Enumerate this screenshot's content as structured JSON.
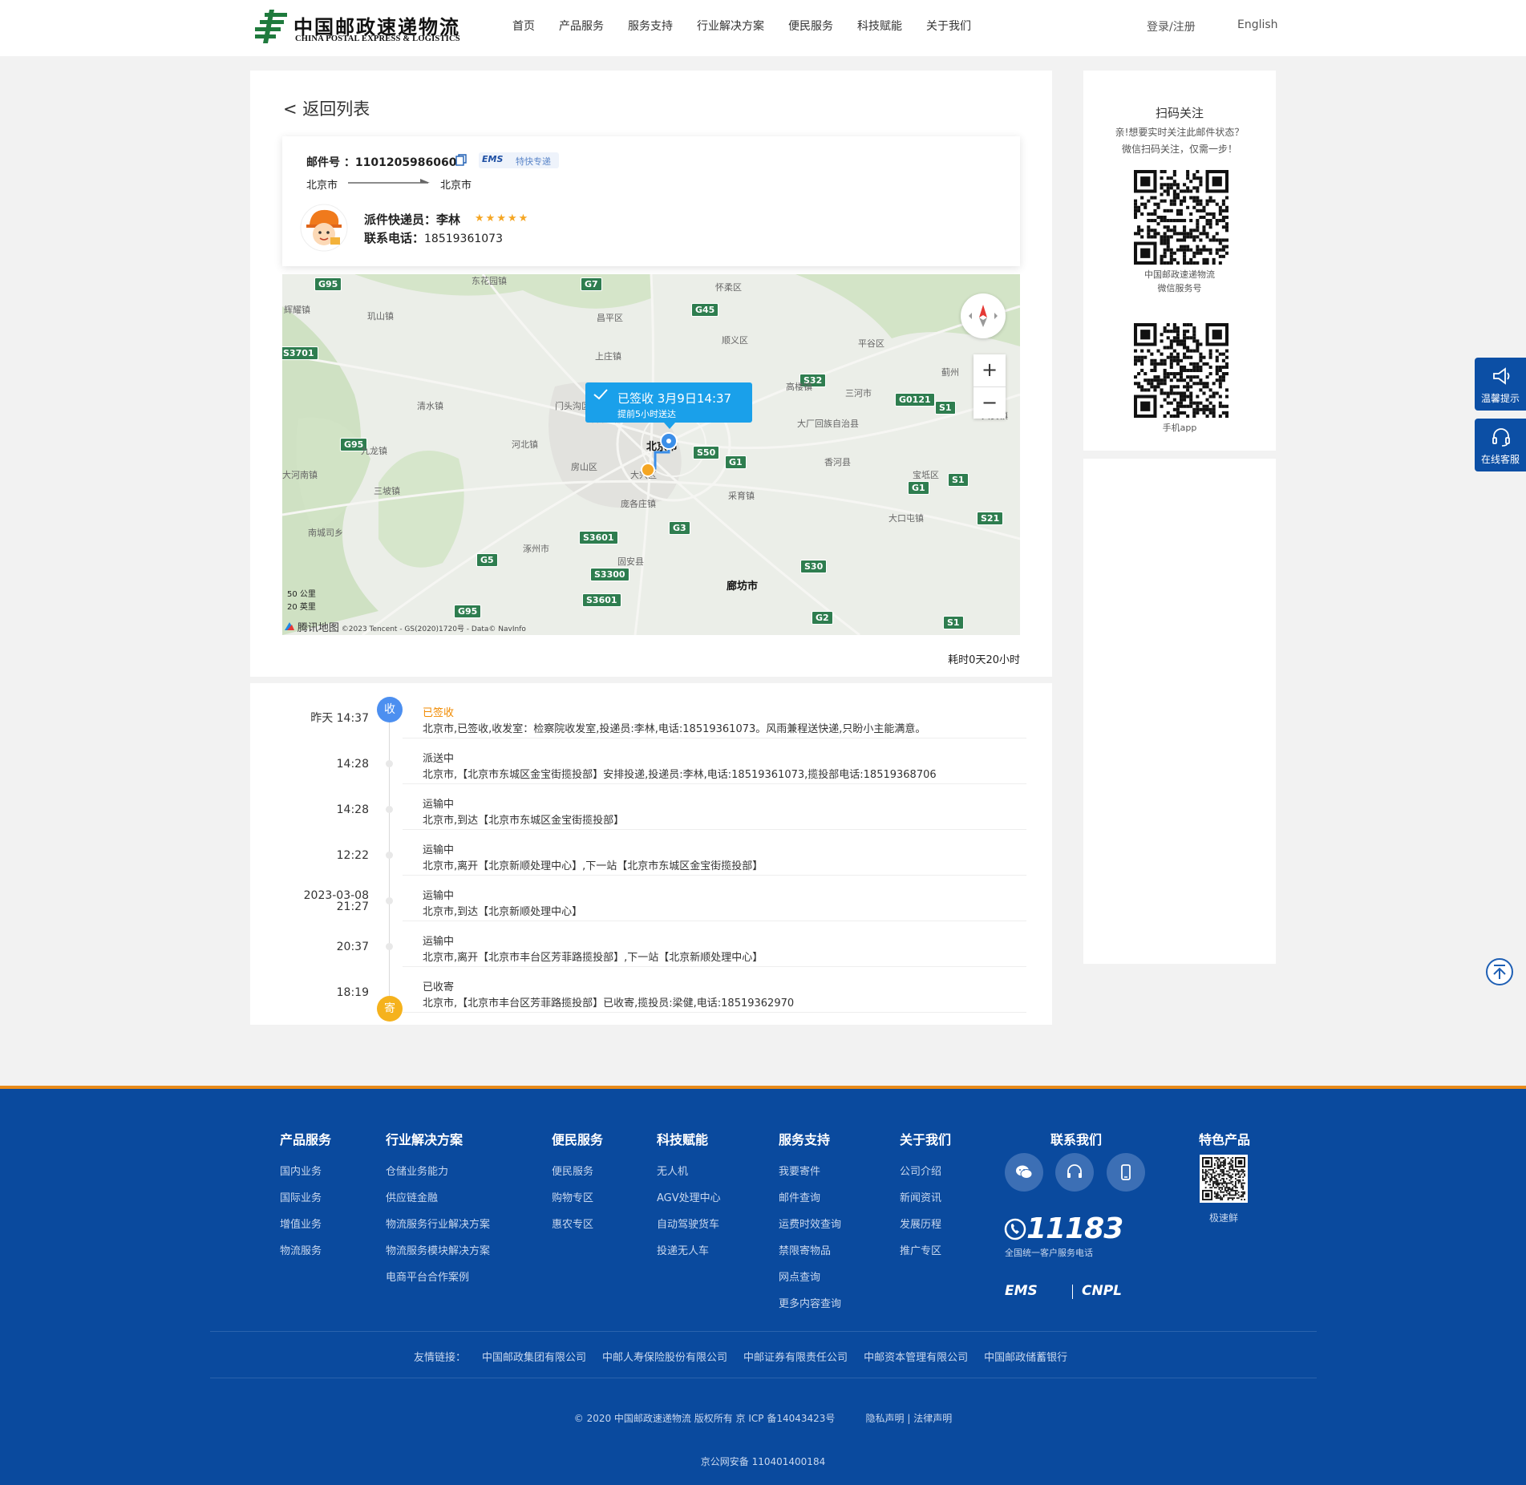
{
  "header": {
    "logo_cn": "中国邮政速递物流",
    "logo_en": "CHINA POSTAL EXPRESS & LOGISTICS",
    "nav": [
      "首页",
      "产品服务",
      "服务支持",
      "行业解决方案",
      "便民服务",
      "科技赋能",
      "关于我们"
    ],
    "login": "登录/注册",
    "language": "English"
  },
  "detail": {
    "back_label": "< 返回列表",
    "mail_no_label": "邮件号 ：1101205986060",
    "ems_logo": "EMS",
    "ems_type": "特快专递",
    "origin": "北京市",
    "destination": "北京市",
    "courier_label": "派件快递员：李林",
    "rating_stars": 5,
    "phone_label": "联系电话：",
    "phone_value": "18519361073",
    "duration": "耗时0天20小时"
  },
  "map": {
    "popup_title": "已签收  3月9日14:37",
    "popup_sub": "提前5小时送达",
    "city": "北京市",
    "city2": "廊坊市",
    "zoom_in": "+",
    "zoom_out": "−",
    "scale_metric": "50 公里",
    "scale_imperial": "20 英里",
    "provider": "腾讯地图",
    "attribution": "©2023 Tencent - GS(2020)1720号 - Data© NavInfo",
    "roads": [
      "G95",
      "G7",
      "G45",
      "S3701",
      "S32",
      "G0121",
      "S1",
      "G95",
      "S50",
      "G1",
      "G1",
      "S1",
      "S21",
      "G3",
      "S3601",
      "G5",
      "S3300",
      "S30",
      "S3601",
      "G95",
      "G2",
      "S1"
    ],
    "places": [
      "东花园镇",
      "怀柔区",
      "辉耀镇",
      "玑山镇",
      "昌平区",
      "顺义区",
      "平谷区",
      "上庄镇",
      "高楼镇",
      "三河市",
      "清水镇",
      "门头沟区",
      "石景山区",
      "大厂回族自治县",
      "九龙镇",
      "河北镇",
      "房山区",
      "大兴区",
      "香河县",
      "宝坻区",
      "大河南镇",
      "三坡镇",
      "庞各庄镇",
      "采育镇",
      "大口屯镇",
      "南城司乡",
      "涿州市",
      "固安县",
      "蓟州",
      "大安镇"
    ]
  },
  "timeline": [
    {
      "time": "昨天 14:37",
      "time2": "",
      "status": "已签收",
      "desc": "北京市,已签收,收发室：检察院收发室,投递员:李林,电话:18519361073。风雨兼程送快递,只盼小主能满意。",
      "marker": "收"
    },
    {
      "time": "14:28",
      "time2": "",
      "status": "派送中",
      "desc": "北京市,【北京市东城区金宝街揽投部】安排投递,投递员:李林,电话:18519361073,揽投部电话:18519368706",
      "marker": ""
    },
    {
      "time": "14:28",
      "time2": "",
      "status": "运输中",
      "desc": "北京市,到达【北京市东城区金宝街揽投部】",
      "marker": ""
    },
    {
      "time": "12:22",
      "time2": "",
      "status": "运输中",
      "desc": "北京市,离开【北京新顺处理中心】,下一站【北京市东城区金宝街揽投部】",
      "marker": ""
    },
    {
      "time": "2023-03-08",
      "time2": "21:27",
      "status": "运输中",
      "desc": "北京市,到达【北京新顺处理中心】",
      "marker": ""
    },
    {
      "time": "20:37",
      "time2": "",
      "status": "运输中",
      "desc": "北京市,离开【北京市丰台区芳菲路揽投部】,下一站【北京新顺处理中心】",
      "marker": ""
    },
    {
      "time": "18:19",
      "time2": "",
      "status": "已收寄",
      "desc": "北京市,【北京市丰台区芳菲路揽投部】已收寄,揽投员:梁健,电话:18519362970",
      "marker": "寄"
    }
  ],
  "sidebar": {
    "title": "扫码关注",
    "sub1": "亲!想要实时关注此邮件状态？",
    "sub2": "微信扫码关注，仅需一步！",
    "qr1_cap1": "中国邮政速递物流",
    "qr1_cap2": "微信服务号",
    "qr2_cap": "手机app"
  },
  "float": {
    "tips": "温馨提示",
    "service": "在线客服"
  },
  "footer": {
    "columns": [
      {
        "title": "产品服务",
        "items": [
          "国内业务",
          "国际业务",
          "增值业务",
          "物流服务"
        ]
      },
      {
        "title": "行业解决方案",
        "items": [
          "仓储业务能力",
          "供应链金融",
          "物流服务行业解决方案",
          "物流服务模块解决方案",
          "电商平台合作案例"
        ]
      },
      {
        "title": "便民服务",
        "items": [
          "便民服务",
          "购物专区",
          "惠农专区"
        ]
      },
      {
        "title": "科技赋能",
        "items": [
          "无人机",
          "AGV处理中心",
          "自动驾驶货车",
          "投递无人车"
        ]
      },
      {
        "title": "服务支持",
        "items": [
          "我要寄件",
          "邮件查询",
          "运费时效查询",
          "禁限寄物品",
          "网点查询",
          "更多内容查询"
        ]
      },
      {
        "title": "关于我们",
        "items": [
          "公司介绍",
          "新闻资讯",
          "发展历程",
          "推广专区"
        ]
      }
    ],
    "contact_title": "联系我们",
    "hotline": "11183",
    "hotline_sub": "全国统一客户服务电话",
    "brand1": "EMS",
    "brand2": "CNPL",
    "special_title": "特色产品",
    "special_cap": "极速鲜",
    "friend_label": "友情链接：",
    "friend_links": [
      "中国邮政集团有限公司",
      "中邮人寿保险股份有限公司",
      "中邮证券有限责任公司",
      "中邮资本管理有限公司",
      "中国邮政储蓄银行"
    ],
    "copyright": "© 2020 中国邮政速递物流 版权所有 京 ICP 备14043423号          隐私声明 | 法律声明",
    "police": "京公网安备 110401400184"
  },
  "colors": {
    "brand_blue": "#0a4a9e",
    "accent_orange": "#e88a1a",
    "map_popup": "#1aa0ea",
    "road_green": "#2e7d4f"
  }
}
